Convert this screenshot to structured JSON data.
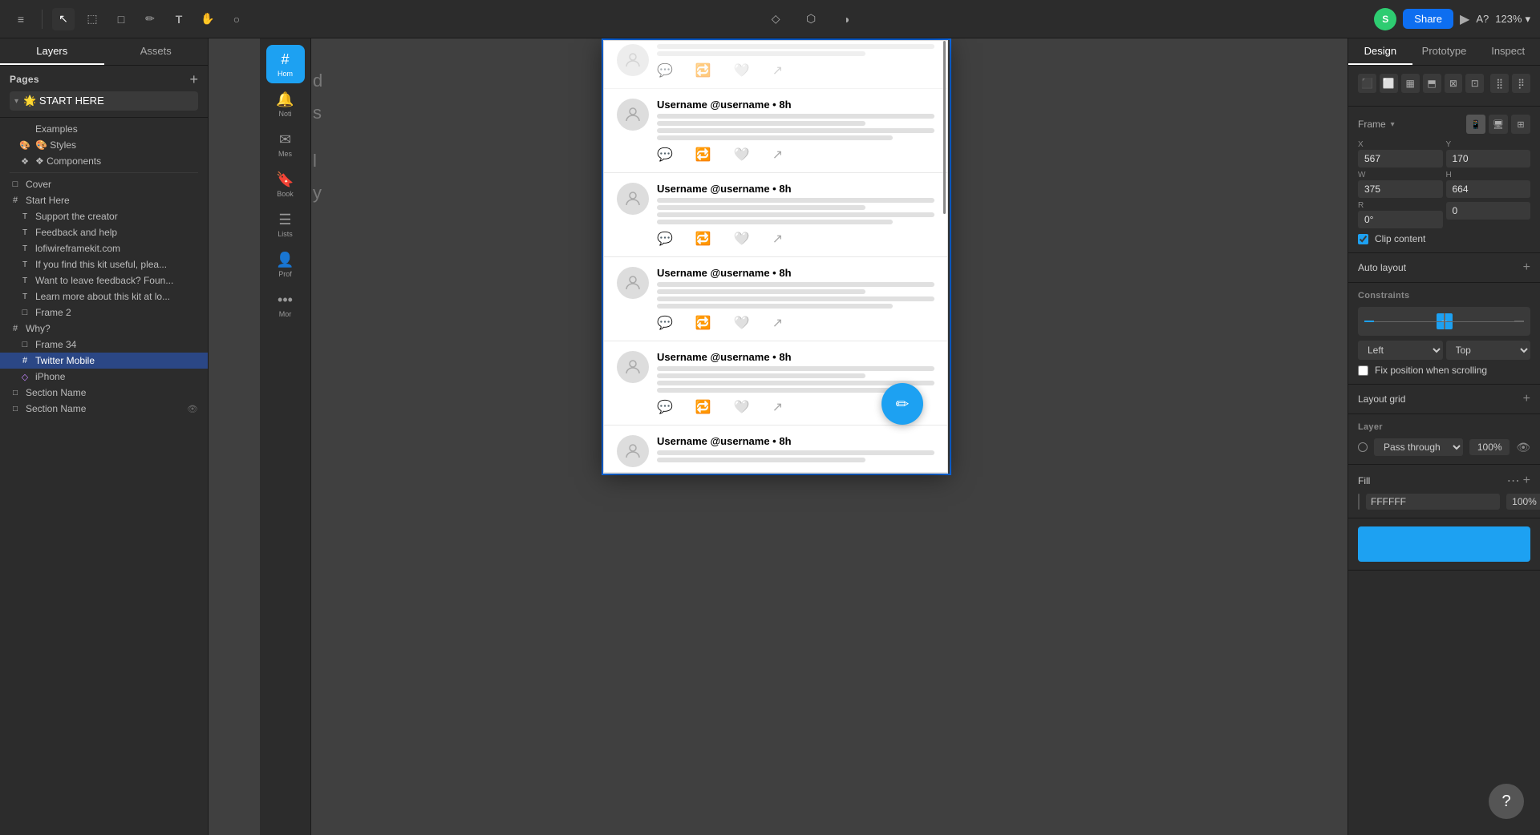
{
  "topbar": {
    "tool_items": [
      {
        "icon": "≡",
        "label": "menu",
        "active": false
      },
      {
        "icon": "↖",
        "label": "select",
        "active": true
      },
      {
        "icon": "⬚",
        "label": "frame",
        "active": false
      },
      {
        "icon": "□",
        "label": "shape",
        "active": false
      },
      {
        "icon": "✏",
        "label": "pen",
        "active": false
      },
      {
        "icon": "T",
        "label": "text",
        "active": false
      },
      {
        "icon": "✋",
        "label": "hand",
        "active": false
      },
      {
        "icon": "○",
        "label": "comment",
        "active": false
      }
    ],
    "center_items": [
      {
        "icon": "◇",
        "label": "pen-tool"
      },
      {
        "icon": "⬡",
        "label": "components"
      },
      {
        "icon": "◑",
        "label": "contrast"
      }
    ],
    "share_label": "Share",
    "play_icon": "▶",
    "zoom_label": "123%",
    "avatar_initial": "S"
  },
  "left_panel": {
    "tabs": [
      "Layers",
      "Assets"
    ],
    "active_tab": "Layers",
    "pages_title": "Pages",
    "add_icon": "+",
    "pages": [
      {
        "label": "🌟 START HERE",
        "active": true,
        "expanded": true
      },
      {
        "label": "Examples",
        "indent": true
      },
      {
        "label": "🎨 Styles",
        "indent": true
      },
      {
        "label": "❖ Components",
        "indent": true
      }
    ],
    "layers": [
      {
        "icon": "□",
        "label": "Cover",
        "indent": 0
      },
      {
        "icon": "#",
        "label": "Start Here",
        "indent": 0
      },
      {
        "icon": "T",
        "label": "Support the creator",
        "indent": 1
      },
      {
        "icon": "T",
        "label": "Feedback and help",
        "indent": 1
      },
      {
        "icon": "T",
        "label": "lofiwireframekit.com",
        "indent": 1
      },
      {
        "icon": "T",
        "label": "If you find this kit useful, plea...",
        "indent": 1
      },
      {
        "icon": "T",
        "label": "Want to leave feedback? Foun...",
        "indent": 1
      },
      {
        "icon": "T",
        "label": "Learn more about this kit at lo...",
        "indent": 1
      },
      {
        "icon": "□",
        "label": "Frame 2",
        "indent": 1
      },
      {
        "icon": "#",
        "label": "Why?",
        "indent": 0
      },
      {
        "icon": "□",
        "label": "Frame 34",
        "indent": 1
      },
      {
        "icon": "#",
        "label": "Twitter Mobile",
        "indent": 1,
        "active": true
      },
      {
        "icon": "◇",
        "label": "iPhone",
        "indent": 1
      },
      {
        "icon": "□",
        "label": "Section Name",
        "indent": 0
      },
      {
        "icon": "□",
        "label": "Section Name",
        "indent": 0,
        "has_eye": true
      }
    ]
  },
  "canvas": {
    "tweets": [
      {
        "username": "Username @username • 8h",
        "lines": [
          "long",
          "short",
          "long",
          "med"
        ]
      },
      {
        "username": "Username @username • 8h",
        "lines": [
          "long",
          "short",
          "long",
          "med"
        ]
      },
      {
        "username": "Username @username • 8h",
        "lines": [
          "long",
          "short",
          "long",
          "med"
        ]
      },
      {
        "username": "Username @username • 8h",
        "lines": [
          "long",
          "short",
          "long",
          "med"
        ]
      },
      {
        "username": "Username @username • 8h",
        "lines": [
          "long",
          "short",
          "long",
          "med"
        ]
      }
    ],
    "fab_icon": "✏",
    "side_nav": [
      {
        "icon": "#",
        "label": "Home",
        "active": true
      },
      {
        "icon": "🔔",
        "label": "Noti"
      },
      {
        "icon": "✉",
        "label": "Mes"
      },
      {
        "icon": "🔖",
        "label": "Book"
      },
      {
        "icon": "☰",
        "label": "Lists"
      },
      {
        "icon": "👤",
        "label": "Prof"
      },
      {
        "icon": "•••",
        "label": "Mor"
      }
    ]
  },
  "right_panel": {
    "tabs": [
      "Design",
      "Prototype",
      "Inspect"
    ],
    "active_tab": "Design",
    "align_buttons": [
      "⬛",
      "⬜",
      "▦",
      "⬒",
      "⊠",
      "⊡"
    ],
    "frame_label": "Frame",
    "frame_options": [
      "mobile",
      "desktop",
      "expand"
    ],
    "x_label": "X",
    "x_value": "567",
    "y_label": "Y",
    "y_value": "170",
    "w_label": "W",
    "w_value": "375",
    "h_label": "H",
    "h_value": "664",
    "r_label": "R",
    "r_value": "0°",
    "clip_label": "Clip content",
    "clip_checked": true,
    "auto_layout_label": "Auto layout",
    "constraints_label": "Constraints",
    "constraint_h": "Left",
    "constraint_v": "Top",
    "fix_scroll_label": "Fix position when scrolling",
    "layout_grid_label": "Layout grid",
    "layer_label": "Layer",
    "pass_through_label": "Pass through",
    "opacity_value": "100%",
    "fill_label": "Fill",
    "fill_hex": "FFFFFF",
    "fill_opacity": "100%",
    "fill_add_icon": "+",
    "help_icon": "?"
  }
}
